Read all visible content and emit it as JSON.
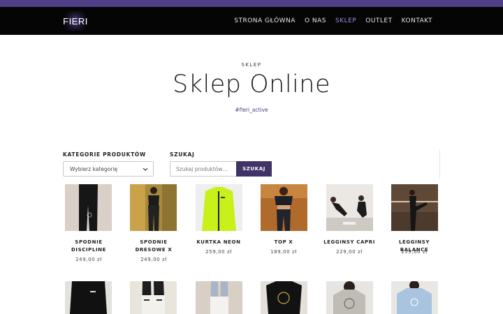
{
  "brand": {
    "logo_text": "FIERI"
  },
  "nav": {
    "items": [
      {
        "label": "STRONA GŁÓWNA"
      },
      {
        "label": "O NAS"
      },
      {
        "label": "SKLEP"
      },
      {
        "label": "OUTLET"
      },
      {
        "label": "KONTAKT"
      }
    ],
    "active_index": 2
  },
  "hero": {
    "eyebrow": "SKLEP",
    "title": "Sklep Online",
    "hashtag": "#fieri_active"
  },
  "filters": {
    "category_label": "KATEGORIE PRODUKTÓW",
    "category_selected": "Wybierz kategorię",
    "search_label": "SZUKAJ",
    "search_placeholder": "Szukaj produktów…",
    "search_button": "SZUKAJ"
  },
  "products": [
    {
      "name": "SPODNIE DISCIPLINE",
      "price": "249,00 zł"
    },
    {
      "name": "SPODNIE DRESOWE X",
      "price": "249,00 zł"
    },
    {
      "name": "KURTKA NEON",
      "price": "259,00 zł"
    },
    {
      "name": "TOP X",
      "price": "189,00 zł"
    },
    {
      "name": "LEGGINSY CAPRI",
      "price": "229,00 zł"
    },
    {
      "name": "LEGGINSY BALANCE",
      "price": "259,00 zł"
    }
  ],
  "colors": {
    "accent": "#4e3f86",
    "nav_active": "#9b8ce0",
    "navbar_bg": "#050505",
    "button_bg": "#3f3368"
  }
}
